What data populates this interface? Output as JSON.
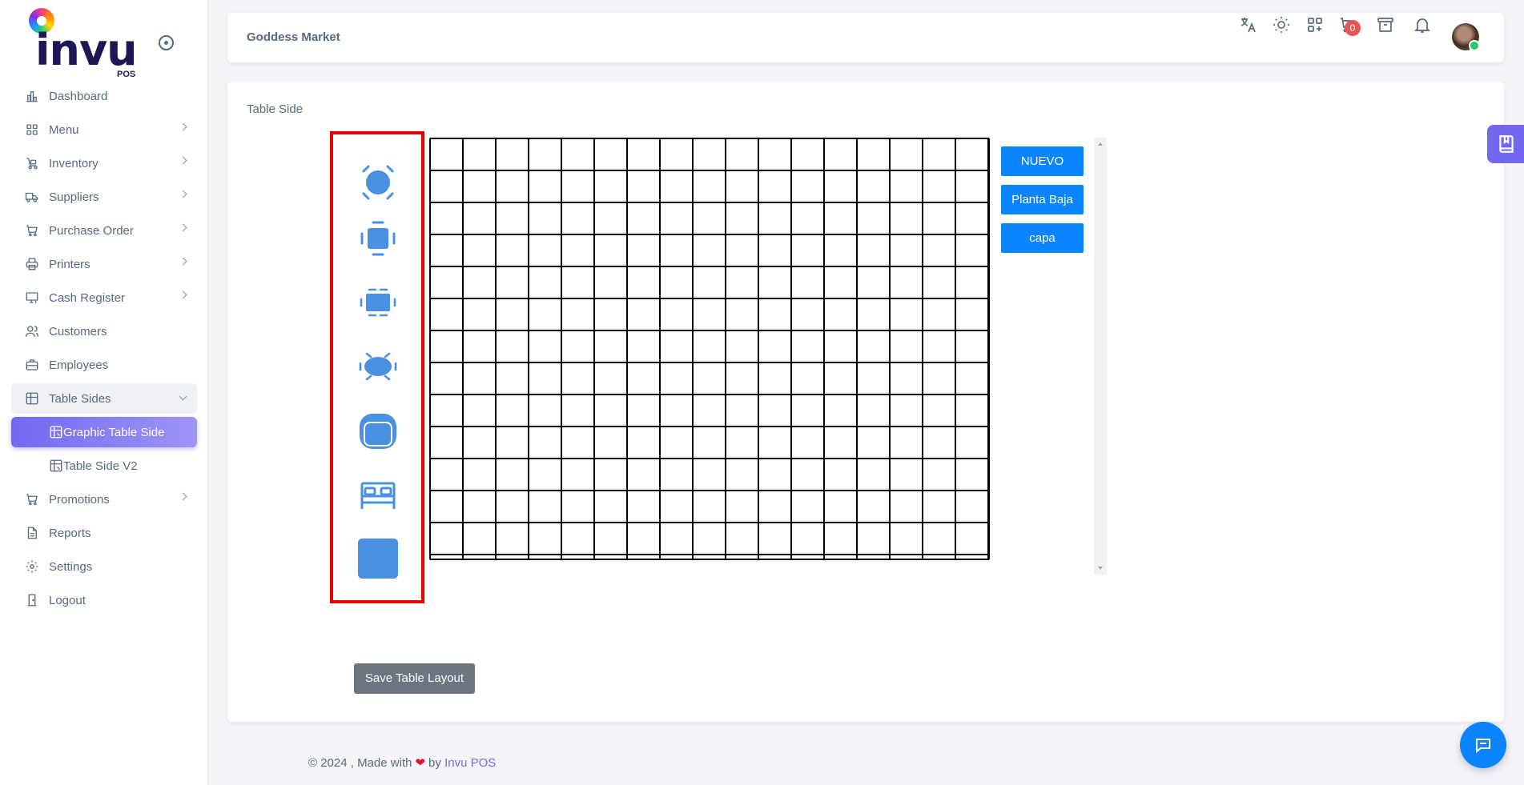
{
  "app": {
    "brand": "invu",
    "brand_sub": "POS"
  },
  "sidebar": {
    "items": [
      {
        "label": "Dashboard",
        "icon": "chart-bar-icon",
        "has_children": false
      },
      {
        "label": "Menu",
        "icon": "grid-icon",
        "has_children": true
      },
      {
        "label": "Inventory",
        "icon": "cart-dolly-icon",
        "has_children": true
      },
      {
        "label": "Suppliers",
        "icon": "truck-icon",
        "has_children": true
      },
      {
        "label": "Purchase Order",
        "icon": "cart-icon",
        "has_children": true
      },
      {
        "label": "Printers",
        "icon": "printer-icon",
        "has_children": true
      },
      {
        "label": "Cash Register",
        "icon": "register-icon",
        "has_children": true
      },
      {
        "label": "Customers",
        "icon": "users-icon",
        "has_children": false
      },
      {
        "label": "Employees",
        "icon": "briefcase-icon",
        "has_children": false
      },
      {
        "label": "Table Sides",
        "icon": "table-icon",
        "has_children": true,
        "expanded": true
      },
      {
        "label": "Promotions",
        "icon": "cart-icon",
        "has_children": true
      },
      {
        "label": "Reports",
        "icon": "file-icon",
        "has_children": false
      },
      {
        "label": "Settings",
        "icon": "gear-icon",
        "has_children": false
      },
      {
        "label": "Logout",
        "icon": "door-icon",
        "has_children": false
      }
    ],
    "sub_items": [
      {
        "label": "Graphic Table Side",
        "active": true
      },
      {
        "label": "Table Side V2",
        "active": false
      }
    ]
  },
  "header": {
    "store_name": "Goddess Market",
    "cart_count": "0",
    "icons": [
      "translate-icon",
      "sun-icon",
      "apps-add-icon",
      "cart-icon",
      "archive-icon",
      "bell-icon",
      "avatar"
    ]
  },
  "main": {
    "title": "Table Side",
    "palette": [
      "round-table-4-chairs-icon",
      "square-table-4-chairs-icon",
      "rect-table-6-chairs-icon",
      "oval-table-6-chairs-icon",
      "armchair-icon",
      "bed-icon",
      "square-block-icon"
    ],
    "grid": {
      "columns": 17,
      "rows": 13
    },
    "layers": [
      "NUEVO",
      "Planta Baja",
      "capa"
    ],
    "save_label": "Save Table Layout"
  },
  "footer": {
    "prefix": "© 2024 , Made with",
    "by": "by",
    "link": "Invu POS"
  },
  "colors": {
    "accent": "#7367f0",
    "layer_button": "#0a84ff",
    "palette_border": "#e60000",
    "furniture": "#4a90e2"
  }
}
